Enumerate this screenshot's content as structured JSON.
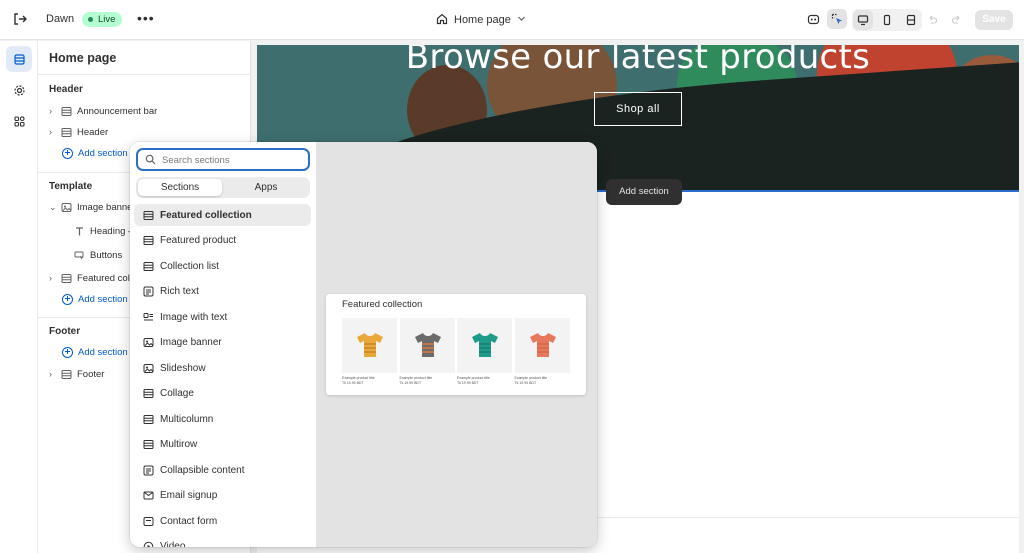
{
  "topbar": {
    "theme_name": "Dawn",
    "status": "Live",
    "more": "•••",
    "page": "Home page",
    "save": "Save"
  },
  "sidebar": {
    "title": "Home page",
    "groups": [
      {
        "label": "Header",
        "items": [
          "Announcement bar",
          "Header"
        ],
        "add": "Add section"
      },
      {
        "label": "Template",
        "items": [
          "Image banner",
          "Heading –",
          "Buttons",
          "Featured coll"
        ],
        "add": "Add section"
      },
      {
        "label": "Footer",
        "items": [
          "Footer"
        ],
        "add": "Add section"
      }
    ]
  },
  "preview": {
    "heading": "Browse our latest products",
    "button": "Shop all",
    "add_section_tooltip": "Add section"
  },
  "picker": {
    "search_placeholder": "Search sections",
    "tabs": [
      "Sections",
      "Apps"
    ],
    "sections": [
      "Featured collection",
      "Featured product",
      "Collection list",
      "Rich text",
      "Image with text",
      "Image banner",
      "Slideshow",
      "Collage",
      "Multicolumn",
      "Multirow",
      "Collapsible content",
      "Email signup",
      "Contact form",
      "Video"
    ],
    "preview_card": {
      "title": "Featured collection",
      "products": [
        {
          "color": "#e8a93a",
          "stripe": "#c9822a",
          "name": "Example product title",
          "price": "Tk 19.99 BDT"
        },
        {
          "color": "#6b6b6b",
          "stripe": "#e07a3d",
          "name": "Example product title",
          "price": "Tk 19.99 BDT"
        },
        {
          "color": "#1f9b8a",
          "stripe": "#178073",
          "name": "Example product title",
          "price": "Tk 19.99 BDT"
        },
        {
          "color": "#e8785c",
          "stripe": "#d5664b",
          "name": "Example product title",
          "price": "Tk 19.99 BDT"
        }
      ]
    }
  },
  "colors": {
    "accent": "#005bd3",
    "focus": "#2c6ecb",
    "live_bg": "#b4fed2"
  }
}
